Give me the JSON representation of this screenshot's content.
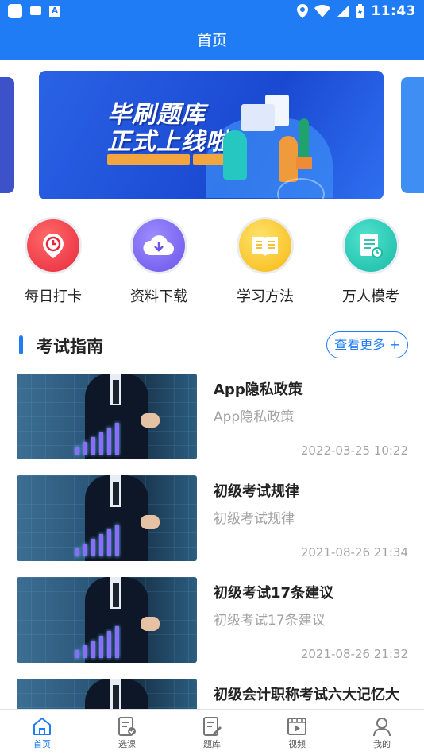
{
  "status_bar": {
    "time": "11:43",
    "notification_letter": "A"
  },
  "header": {
    "title": "首页"
  },
  "banner": {
    "line1": "毕刷题库",
    "line2": "正式上线啦!"
  },
  "quick_entries": [
    {
      "label": "每日打卡",
      "icon": "alarm-clock-icon"
    },
    {
      "label": "资料下载",
      "icon": "cloud-download-icon"
    },
    {
      "label": "学习方法",
      "icon": "book-icon"
    },
    {
      "label": "万人模考",
      "icon": "exam-paper-icon"
    }
  ],
  "section": {
    "title": "考试指南",
    "more_label": "查看更多 +"
  },
  "articles": [
    {
      "title": "App隐私政策",
      "subtitle": "App隐私政策",
      "date": "2022-03-25 10:22"
    },
    {
      "title": "初级考试规律",
      "subtitle": "初级考试规律",
      "date": "2021-08-26 21:34"
    },
    {
      "title": "初级考试17条建议",
      "subtitle": "初级考试17条建议",
      "date": "2021-08-26 21:32"
    },
    {
      "title": "初级会计职称考试六大记忆大",
      "subtitle": "",
      "date": ""
    }
  ],
  "tabs": [
    {
      "label": "首页",
      "icon": "home-icon",
      "active": true
    },
    {
      "label": "选课",
      "icon": "course-icon",
      "active": false
    },
    {
      "label": "题库",
      "icon": "question-bank-icon",
      "active": false
    },
    {
      "label": "视频",
      "icon": "video-icon",
      "active": false
    },
    {
      "label": "我的",
      "icon": "profile-icon",
      "active": false
    }
  ],
  "colors": {
    "primary": "#1f7cf5",
    "muted_text": "#a3a3a3"
  }
}
